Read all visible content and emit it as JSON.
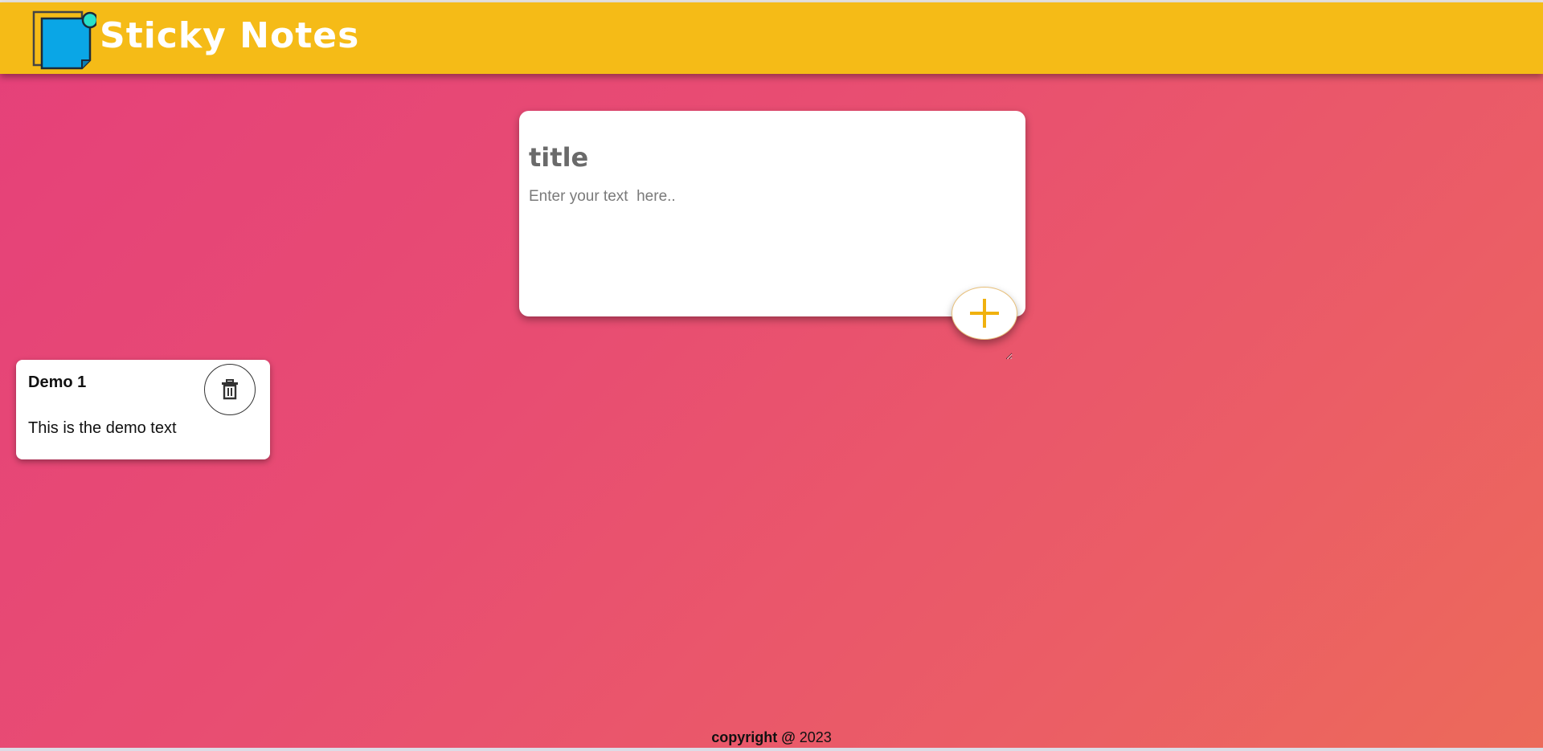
{
  "header": {
    "app_title": "Sticky Notes",
    "logo_icon": "sticky-note-pin-icon",
    "background_color": "#f5bb17"
  },
  "composer": {
    "title_placeholder": "title",
    "text_placeholder": "Enter your text  here..",
    "add_icon": "plus-icon",
    "accent_color": "#f0b10f"
  },
  "notes": [
    {
      "title": "Demo 1",
      "text": "This is the demo text",
      "delete_icon": "trash-icon"
    }
  ],
  "footer": {
    "copyright_label": "copyright @",
    "year": "2023"
  },
  "theme": {
    "gradient_start": "#e5407a",
    "gradient_end": "#ec6a5a"
  }
}
